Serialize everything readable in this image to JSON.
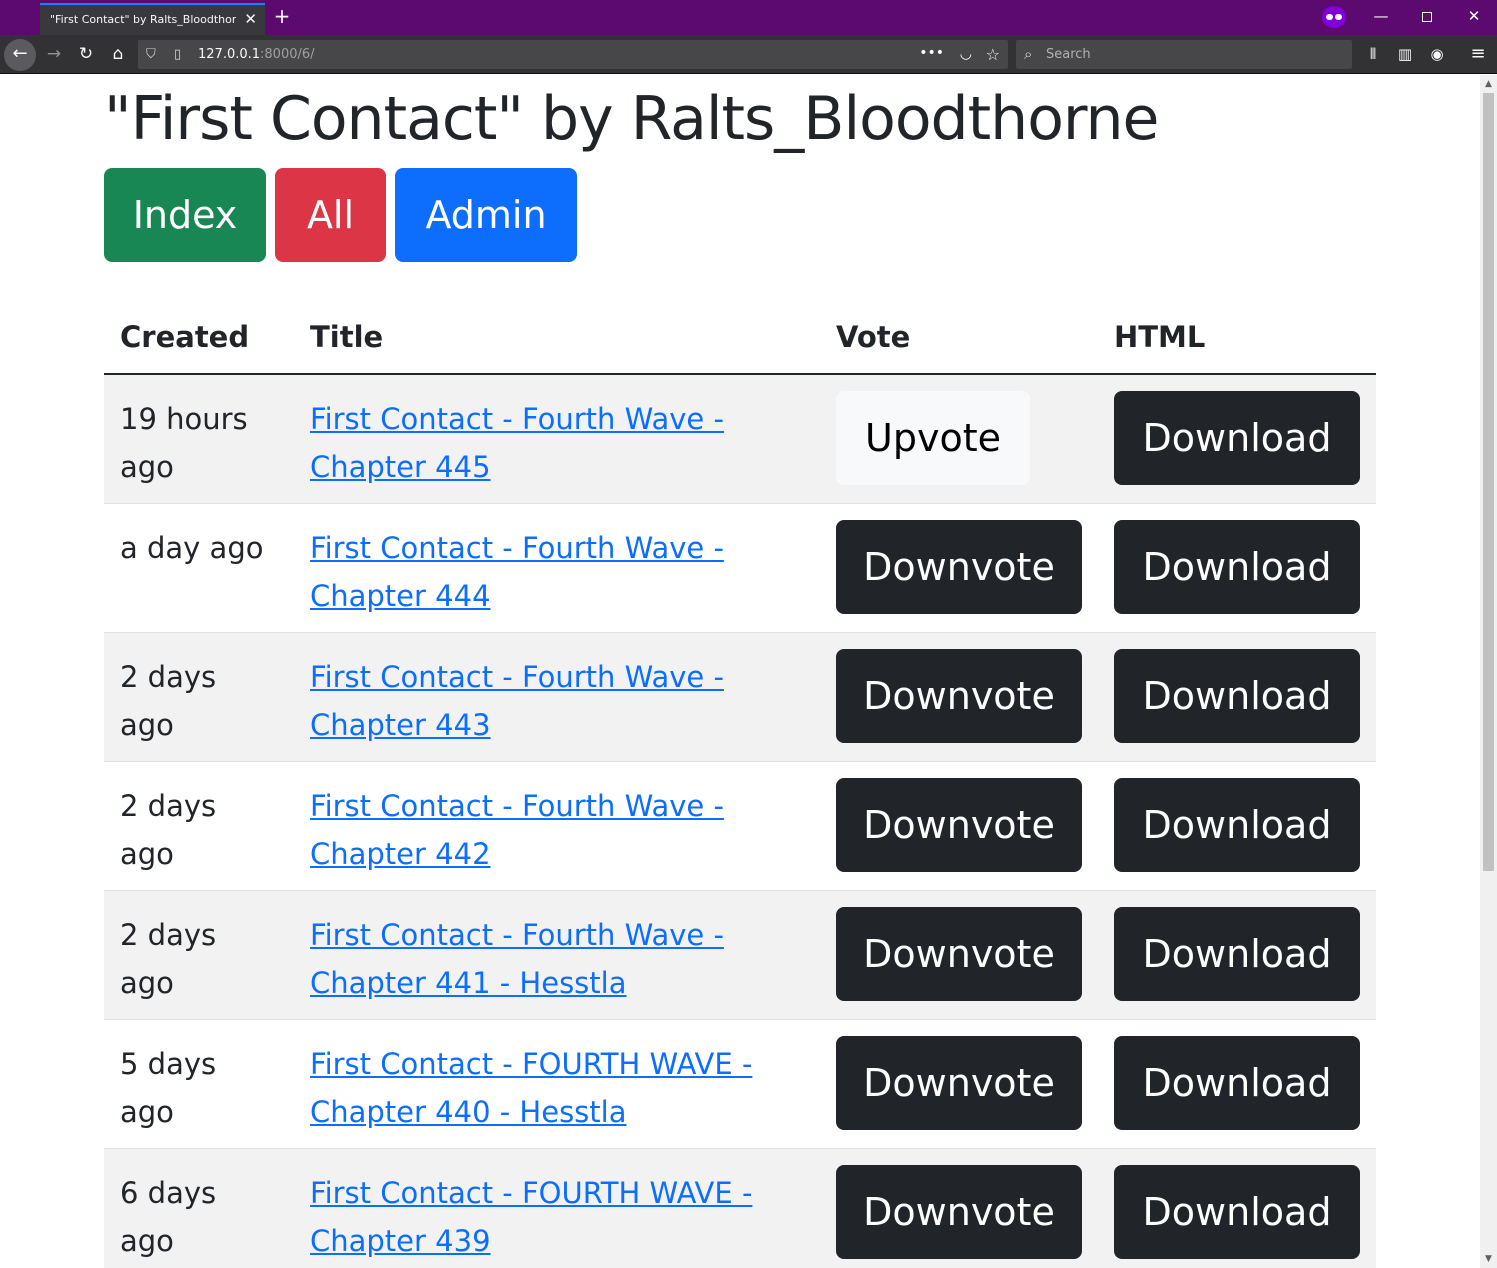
{
  "browser": {
    "tab_title": "\"First Contact\" by Ralts_Bloodthorne",
    "url_host": "127.0.0.1",
    "url_path": ":8000/6/",
    "search_placeholder": "Search"
  },
  "page": {
    "title": "\"First Contact\" by Ralts_Bloodthorne",
    "buttons": {
      "index": "Index",
      "all": "All",
      "admin": "Admin"
    }
  },
  "table": {
    "headers": [
      "Created",
      "Title",
      "Vote",
      "HTML"
    ],
    "rows": [
      {
        "created": "19 hours ago",
        "title": "First Contact - Fourth Wave - Chapter 445",
        "vote": "Upvote",
        "html": "Download"
      },
      {
        "created": "a day ago",
        "title": "First Contact - Fourth Wave - Chapter 444",
        "vote": "Downvote",
        "html": "Download"
      },
      {
        "created": "2 days ago",
        "title": "First Contact - Fourth Wave - Chapter 443",
        "vote": "Downvote",
        "html": "Download"
      },
      {
        "created": "2 days ago",
        "title": "First Contact - Fourth Wave - Chapter 442",
        "vote": "Downvote",
        "html": "Download"
      },
      {
        "created": "2 days ago",
        "title": "First Contact - Fourth Wave - Chapter 441 - Hesstla",
        "vote": "Downvote",
        "html": "Download"
      },
      {
        "created": "5 days ago",
        "title": "First Contact - FOURTH WAVE - Chapter 440 - Hesstla",
        "vote": "Downvote",
        "html": "Download"
      },
      {
        "created": "6 days ago",
        "title": "First Contact - FOURTH WAVE - Chapter 439",
        "vote": "Downvote",
        "html": "Download"
      }
    ]
  },
  "colors": {
    "index": "#198754",
    "all": "#dc3545",
    "admin": "#0d6efd",
    "dark_button": "#212529",
    "link": "#0d6efd",
    "titlebar": "#5c0a70"
  }
}
